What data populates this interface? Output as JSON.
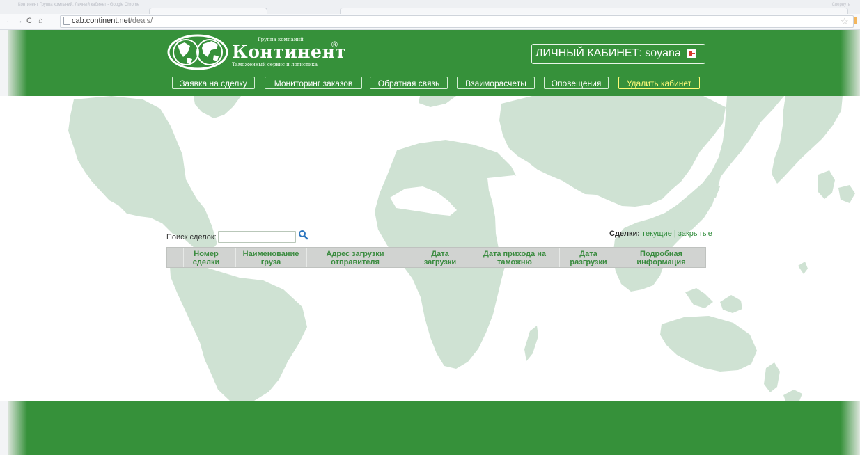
{
  "browser": {
    "window_title": "Континент Группа компаний. Личный кабинет - Google Chrome",
    "url_host": "cab.continent.net",
    "url_path": "/deals/",
    "top_right_text": "Свернуть"
  },
  "header": {
    "group_label": "Группа компаний",
    "brand_name": "Континент",
    "brand_mark": "®",
    "brand_subtitle": "Таможенный сервис и логистика",
    "cabinet_label": "ЛИЧНЫЙ КАБИНЕТ: soyana"
  },
  "nav": [
    {
      "label": "Заявка на сделку"
    },
    {
      "label": "Мониторинг заказов"
    },
    {
      "label": "Обратная связь"
    },
    {
      "label": "Взаиморасчеты"
    },
    {
      "label": "Оповещения"
    },
    {
      "label": "Удалить кабинет"
    }
  ],
  "search": {
    "label": "Поиск сделок:",
    "placeholder": ""
  },
  "deals_filter": {
    "label": "Сделки:",
    "current": "текущие",
    "separator": "|",
    "closed": "закрытые"
  },
  "table": {
    "columns": [
      "Номер сделки",
      "Наименование груза",
      "Адрес загрузки отправителя",
      "Дата загрузки",
      "Дата прихода на таможню",
      "Дата разгрузки",
      "Подробная информация"
    ]
  },
  "colors": {
    "brand_green": "#36913a",
    "map_green": "#cfe2d3",
    "warning_yellow": "#fffa78"
  }
}
